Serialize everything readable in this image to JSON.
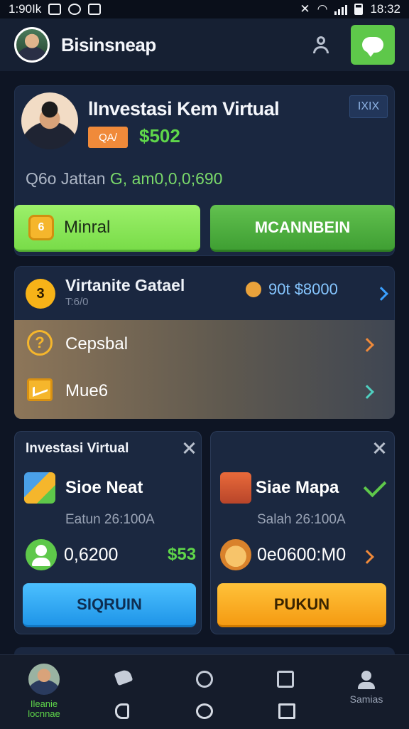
{
  "statusbar": {
    "time_left": "1:90Ik",
    "time_right": "18:32"
  },
  "appbar": {
    "title": "Bisinsneap"
  },
  "hero": {
    "title": "lInvestasi Kem Virtual",
    "tag": "IXIX",
    "badge": "QA/",
    "amount": "$502",
    "sub_prefix": "Q6o  Jattan",
    "sub_highlight": "G, am0,0,0;690",
    "btn_left": "Minral",
    "btn_left_coin": "6",
    "btn_right": "MCANNBEIN"
  },
  "list": {
    "coin_label": "3",
    "title": "Virtanite Gatael",
    "sub": "T:6/0",
    "value": "90t $8000",
    "rows": [
      {
        "label": "Cepsbal",
        "icon": "question-circle-icon"
      },
      {
        "label": "Mue6",
        "icon": "mail-icon"
      }
    ]
  },
  "cards": {
    "left": {
      "header": "Investasi Virtual",
      "title": "Sioe Neat",
      "meta": "Eatun 26:100A",
      "value": "0,6200",
      "price": "$53",
      "button": "SIQRUIN"
    },
    "right": {
      "title": "Siae Mapa",
      "meta": "Salah 26:100A",
      "value": "0e0600:M0",
      "button": "PUKUN"
    }
  },
  "nav": {
    "home_label": "Ileanie\nlocnnae",
    "profile_label": "Samias"
  },
  "colors": {
    "background": "#0e1524",
    "card": "#1a2740",
    "green": "#5ec84a",
    "orange": "#f59b12",
    "blue": "#1f95e8"
  }
}
